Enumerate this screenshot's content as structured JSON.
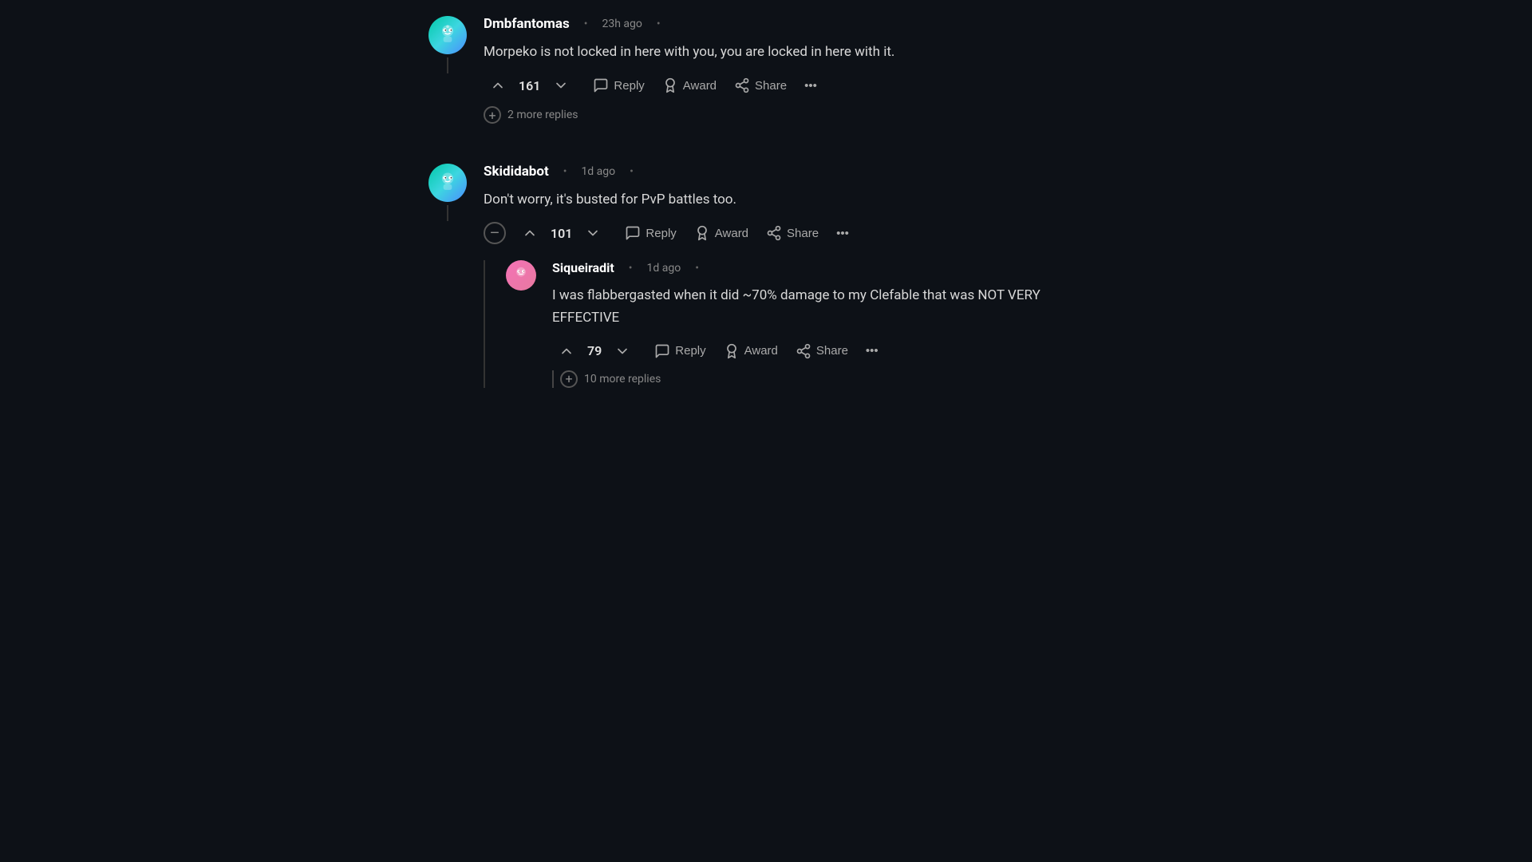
{
  "comments": [
    {
      "id": "comment1",
      "username": "Dmbfantomas",
      "avatar_style": "teal",
      "timestamp": "23h ago",
      "text": "Morpeko is not locked in here with you, you are locked in here with it.",
      "upvotes": 161,
      "has_thread_line": true,
      "more_replies_count": 2,
      "more_replies_label": "2 more replies",
      "actions": [
        "Reply",
        "Award",
        "Share"
      ]
    },
    {
      "id": "comment2",
      "username": "Skididabot",
      "avatar_style": "teal2",
      "timestamp": "1d ago",
      "text": "Don't worry, it's busted for PvP battles too.",
      "upvotes": 101,
      "has_thread_line": true,
      "actions": [
        "Reply",
        "Award",
        "Share"
      ],
      "nested": [
        {
          "id": "nested1",
          "username": "Siqueiradit",
          "avatar_style": "pink",
          "timestamp": "1d ago",
          "text": "I was flabbergasted when it did ~70% damage to my Clefable that was NOT VERY EFFECTIVE",
          "upvotes": 79,
          "more_replies_count": 10,
          "more_replies_label": "10 more replies",
          "actions": [
            "Reply",
            "Award",
            "Share"
          ]
        }
      ]
    }
  ],
  "labels": {
    "reply": "Reply",
    "award": "Award",
    "share": "Share",
    "more": "...",
    "more_replies_prefix": "more replies"
  }
}
